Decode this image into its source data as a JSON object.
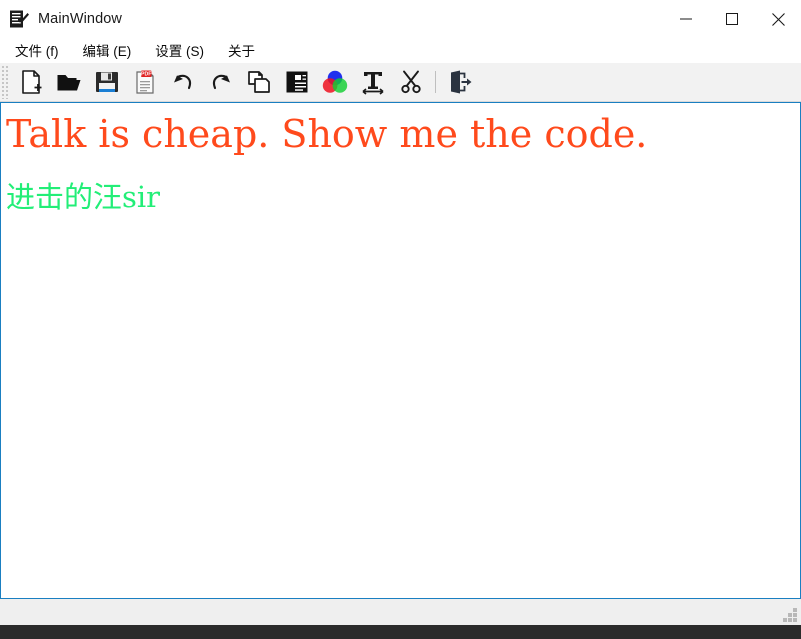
{
  "window": {
    "title": "MainWindow",
    "app_icon": "notepad-pen-icon"
  },
  "window_controls": {
    "minimize": "minimize-icon",
    "maximize": "maximize-icon",
    "close": "close-icon"
  },
  "menubar": {
    "items": [
      {
        "label": "文件 (f)",
        "name": "menu-file"
      },
      {
        "label": "编辑 (E)",
        "name": "menu-edit"
      },
      {
        "label": "设置 (S)",
        "name": "menu-settings"
      },
      {
        "label": "关于",
        "name": "menu-about"
      }
    ]
  },
  "toolbar": {
    "buttons": [
      {
        "name": "new-file-icon",
        "tip": "新建"
      },
      {
        "name": "open-folder-icon",
        "tip": "打开"
      },
      {
        "name": "save-floppy-icon",
        "tip": "保存"
      },
      {
        "name": "export-pdf-icon",
        "tip": "导出PDF"
      },
      {
        "name": "undo-arrow-icon",
        "tip": "撤销"
      },
      {
        "name": "redo-arrow-icon",
        "tip": "重做"
      },
      {
        "name": "copy-pages-icon",
        "tip": "复制"
      },
      {
        "name": "paste-document-icon",
        "tip": "粘贴"
      },
      {
        "name": "color-wheel-icon",
        "tip": "颜色"
      },
      {
        "name": "font-size-t-icon",
        "tip": "字体"
      },
      {
        "name": "scissors-cut-icon",
        "tip": "剪切"
      },
      {
        "name": "exit-door-icon",
        "tip": "退出"
      }
    ]
  },
  "editor": {
    "line1": "Talk is cheap. Show me the code.",
    "line2": "进击的汪sir",
    "line1_color": "#FF4A1C",
    "line2_color": "#22EE77",
    "border_color": "#1A7FC1"
  },
  "statusbar": {
    "text": "",
    "grip": "resize-grip-icon"
  }
}
